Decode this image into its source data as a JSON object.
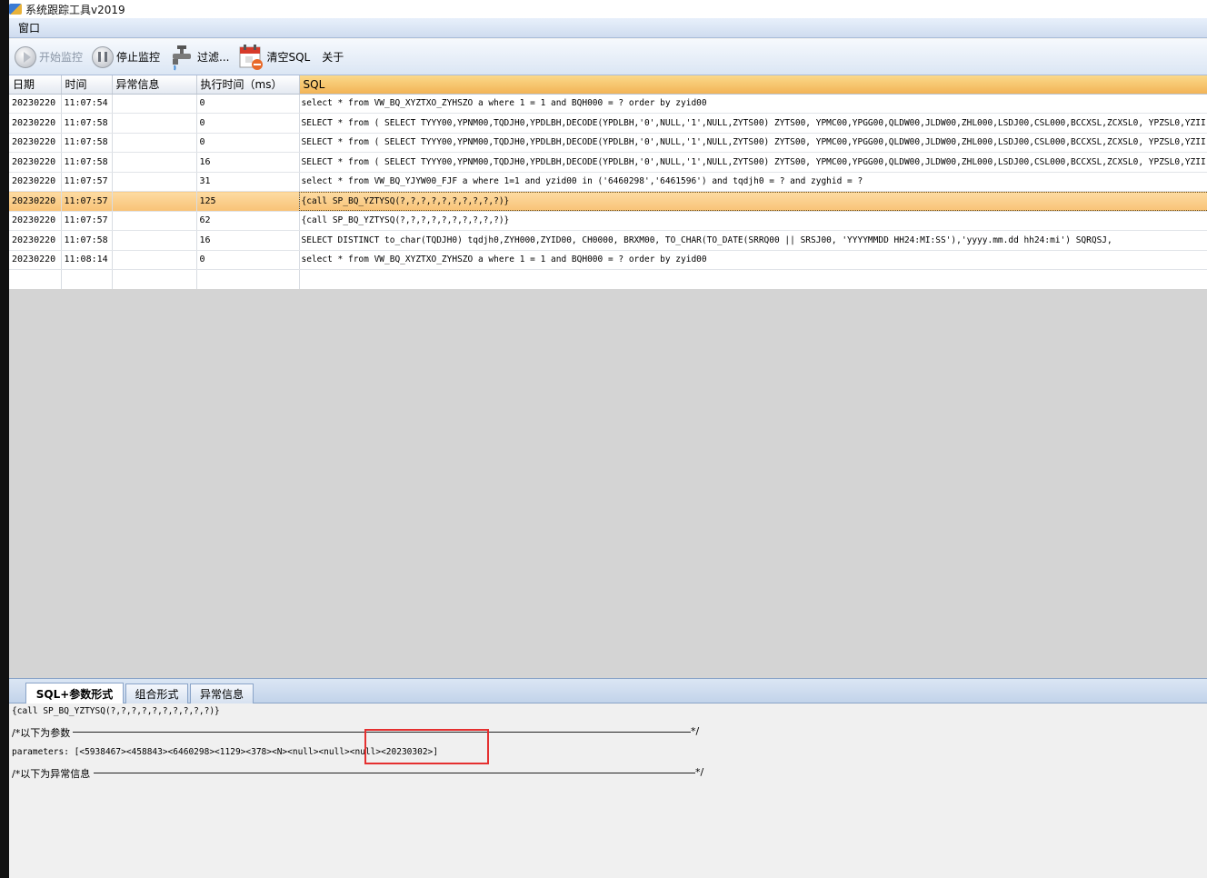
{
  "window": {
    "title": "系统跟踪工具v2019"
  },
  "menu": {
    "items": [
      "窗口"
    ]
  },
  "toolbar": {
    "start": "开始监控",
    "stop": "停止监控",
    "filter": "过滤...",
    "clear": "清空SQL",
    "about": "关于"
  },
  "grid": {
    "headers": {
      "date": "日期",
      "time": "时间",
      "error": "异常信息",
      "duration": "执行时间（ms）",
      "sql": "SQL"
    },
    "rows": [
      {
        "date": "20230220",
        "time": "11:07:54",
        "error": "",
        "duration": "0",
        "sql": "select * from VW_BQ_XYZTXO_ZYHSZO a where 1 = 1  and  BQH000 = ? order by zyid00"
      },
      {
        "date": "20230220",
        "time": "11:07:58",
        "error": "",
        "duration": "0",
        "sql": " SELECT * from ( SELECT  TYYY00,YPNM00,TQDJH0,YPDLBH,DECODE(YPDLBH,'0',NULL,'1',NULL,ZYTS00) ZYTS00,   YPMC00,YPGG00,QLDW00,JLDW00,ZHL000,LSDJ00,CSL000,BCCXSL,ZCXSL0,   YPZSL0,YZII"
      },
      {
        "date": "20230220",
        "time": "11:07:58",
        "error": "",
        "duration": "0",
        "sql": " SELECT * from ( SELECT  TYYY00,YPNM00,TQDJH0,YPDLBH,DECODE(YPDLBH,'0',NULL,'1',NULL,ZYTS00) ZYTS00,   YPMC00,YPGG00,QLDW00,JLDW00,ZHL000,LSDJ00,CSL000,BCCXSL,ZCXSL0,   YPZSL0,YZII"
      },
      {
        "date": "20230220",
        "time": "11:07:58",
        "error": "",
        "duration": "16",
        "sql": " SELECT * from ( SELECT  TYYY00,YPNM00,TQDJH0,YPDLBH,DECODE(YPDLBH,'0',NULL,'1',NULL,ZYTS00) ZYTS00,   YPMC00,YPGG00,QLDW00,JLDW00,ZHL000,LSDJ00,CSL000,BCCXSL,ZCXSL0,   YPZSL0,YZII"
      },
      {
        "date": "20230220",
        "time": "11:07:57",
        "error": "",
        "duration": "31",
        "sql": "select * from VW_BQ_YJYW00_FJF a where 1=1  and yzid00 in ('6460298','6461596') and tqdjh0 = ?  and zyghid = ?"
      },
      {
        "date": "20230220",
        "time": "11:07:57",
        "error": "",
        "duration": "125",
        "sql": "{call SP_BQ_YZTYSQ(?,?,?,?,?,?,?,?,?,?)}"
      },
      {
        "date": "20230220",
        "time": "11:07:57",
        "error": "",
        "duration": "62",
        "sql": "{call SP_BQ_YZTYSQ(?,?,?,?,?,?,?,?,?,?)}"
      },
      {
        "date": "20230220",
        "time": "11:07:58",
        "error": "",
        "duration": "16",
        "sql": " SELECT DISTINCT to_char(TQDJH0) tqdjh0,ZYH000,ZYID00,  CH0000,  BRXM00,                  TO_CHAR(TO_DATE(SRRQ00 || SRSJ00, 'YYYYMMDD HH24:MI:SS'),'yyyy.mm.dd hh24:mi') SQRQSJ,"
      },
      {
        "date": "20230220",
        "time": "11:08:14",
        "error": "",
        "duration": "0",
        "sql": "select * from VW_BQ_XYZTXO_ZYHSZO a where 1 = 1  and  BQH000 = ? order by zyid00"
      }
    ]
  },
  "tabs": [
    "SQL+参数形式",
    "组合形式",
    "异常信息"
  ],
  "detail": {
    "sql_line": "{call SP_BQ_YZTYSQ(?,?,?,?,?,?,?,?,?,?)}",
    "params_header": "/*以下为参数",
    "params_line": "parameters:  [<5938467><458843><6460298><1129><378><N><null><null><null><20230302>]",
    "error_header": "/*以下为异常信息",
    "comment_end": "*/"
  }
}
